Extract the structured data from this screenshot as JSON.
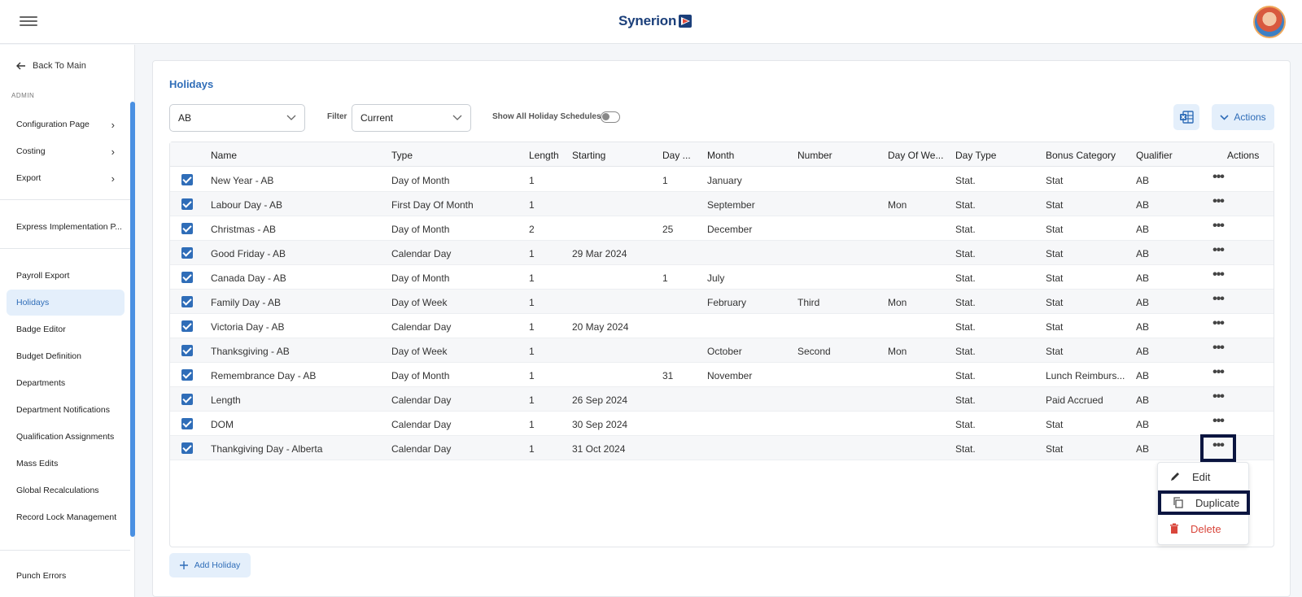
{
  "brand": {
    "name": "Synerion"
  },
  "sidebar": {
    "back_label": "Back To Main",
    "section_label": "ADMIN",
    "items": [
      {
        "label": "Configuration Page",
        "has_children": true
      },
      {
        "label": "Costing",
        "has_children": true
      },
      {
        "label": "Export",
        "has_children": true
      },
      {
        "label": "Express Implementation P...",
        "has_children": false
      },
      {
        "label": "Payroll Export",
        "has_children": false
      },
      {
        "label": "Holidays",
        "has_children": false,
        "active": true
      },
      {
        "label": "Badge Editor",
        "has_children": false
      },
      {
        "label": "Budget Definition",
        "has_children": false
      },
      {
        "label": "Departments",
        "has_children": false
      },
      {
        "label": "Department Notifications",
        "has_children": false
      },
      {
        "label": "Qualification Assignments",
        "has_children": false
      },
      {
        "label": "Mass Edits",
        "has_children": false
      },
      {
        "label": "Global Recalculations",
        "has_children": false
      },
      {
        "label": "Record Lock Management",
        "has_children": false
      },
      {
        "label": "Punch Errors",
        "has_children": false
      }
    ]
  },
  "page": {
    "title": "Holidays",
    "schedule_select": "AB",
    "filter_label": "Filter",
    "filter_value": "Current",
    "toggle_label": "Show All Holiday Schedules",
    "actions_label": "Actions",
    "add_label": "Add Holiday"
  },
  "table": {
    "headers": [
      "Name",
      "Type",
      "Length",
      "Starting",
      "Day ...",
      "Month",
      "Number",
      "Day Of We...",
      "Day Type",
      "Bonus Category",
      "Qualifier",
      "Actions"
    ],
    "rows": [
      [
        "New Year - AB",
        "Day of Month",
        "1",
        "",
        "1",
        "January",
        "",
        "",
        "Stat.",
        "Stat",
        "AB"
      ],
      [
        "Labour Day - AB",
        "First Day Of Month",
        "1",
        "",
        "",
        "September",
        "",
        "Mon",
        "Stat.",
        "Stat",
        "AB"
      ],
      [
        "Christmas - AB",
        "Day of Month",
        "2",
        "",
        "25",
        "December",
        "",
        "",
        "Stat.",
        "Stat",
        "AB"
      ],
      [
        "Good Friday - AB",
        "Calendar Day",
        "1",
        "29 Mar 2024",
        "",
        "",
        "",
        "",
        "Stat.",
        "Stat",
        "AB"
      ],
      [
        "Canada Day - AB",
        "Day of Month",
        "1",
        "",
        "1",
        "July",
        "",
        "",
        "Stat.",
        "Stat",
        "AB"
      ],
      [
        "Family Day - AB",
        "Day of Week",
        "1",
        "",
        "",
        "February",
        "Third",
        "Mon",
        "Stat.",
        "Stat",
        "AB"
      ],
      [
        "Victoria Day - AB",
        "Calendar Day",
        "1",
        "20 May 2024",
        "",
        "",
        "",
        "",
        "Stat.",
        "Stat",
        "AB"
      ],
      [
        "Thanksgiving - AB",
        "Day of Week",
        "1",
        "",
        "",
        "October",
        "Second",
        "Mon",
        "Stat.",
        "Stat",
        "AB"
      ],
      [
        "Remembrance Day - AB",
        "Day of Month",
        "1",
        "",
        "31",
        "November",
        "",
        "",
        "Stat.",
        "Lunch Reimburs...",
        "AB"
      ],
      [
        "Length",
        "Calendar Day",
        "1",
        "26 Sep 2024",
        "",
        "",
        "",
        "",
        "Stat.",
        "Paid Accrued",
        "AB"
      ],
      [
        "DOM",
        "Calendar Day",
        "1",
        "30 Sep 2024",
        "",
        "",
        "",
        "",
        "Stat.",
        "Stat",
        "AB"
      ],
      [
        "Thankgiving Day - Alberta",
        "Calendar Day",
        "1",
        "31 Oct 2024",
        "",
        "",
        "",
        "",
        "Stat.",
        "Stat",
        "AB"
      ]
    ]
  },
  "context_menu": {
    "items": [
      {
        "label": "Edit",
        "icon": "pencil-icon"
      },
      {
        "label": "Duplicate",
        "icon": "copy-icon"
      },
      {
        "label": "Delete",
        "icon": "trash-icon"
      }
    ]
  },
  "colors": {
    "accent": "#2f6db8",
    "danger": "#d9463b",
    "highlight": "#0b1540"
  }
}
